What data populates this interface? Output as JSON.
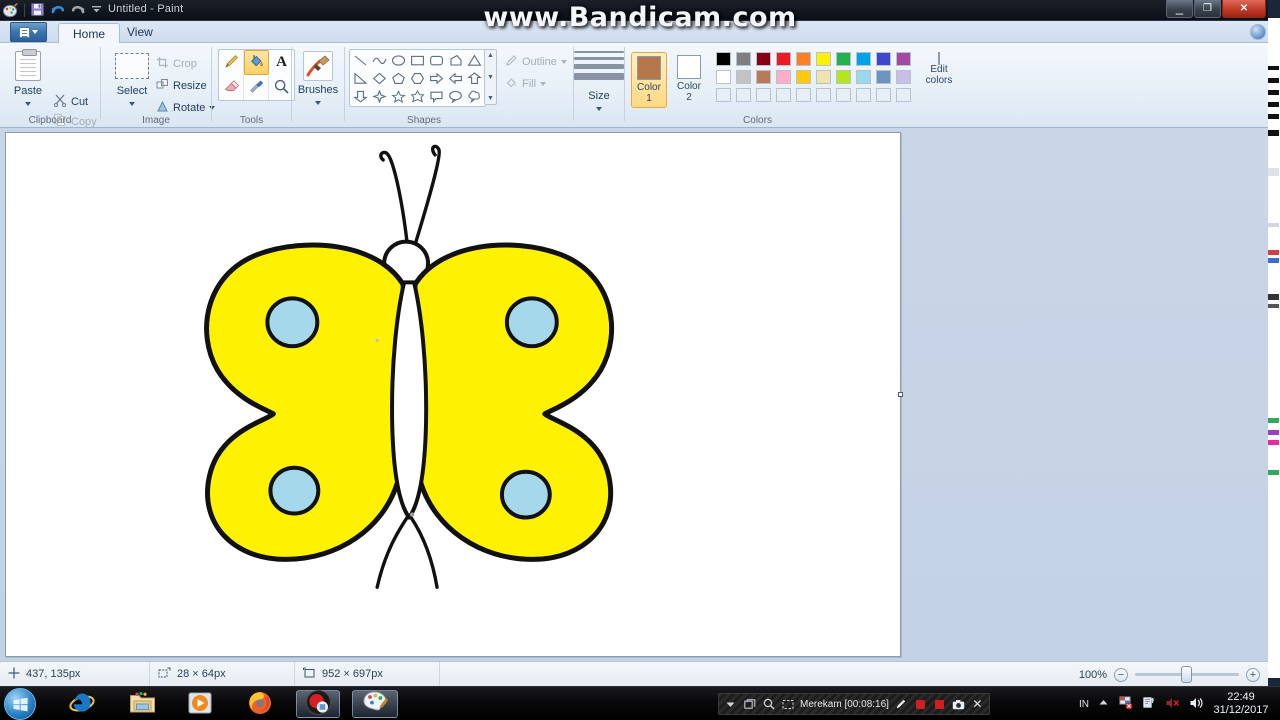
{
  "window": {
    "title": "Untitled - Paint",
    "quick_access": [
      "paint-icon",
      "save-icon",
      "undo-icon",
      "redo-icon",
      "customize-caret-icon"
    ],
    "controls": {
      "minimize": "–",
      "restore": "❐",
      "close": "✕"
    },
    "help_icon": "help-orb-icon"
  },
  "ribbon": {
    "app_menu_label": "",
    "tabs": [
      {
        "label": "Home",
        "active": true
      },
      {
        "label": "View",
        "active": false
      }
    ],
    "groups": [
      {
        "name": "Clipboard",
        "label": "Clipboard",
        "paste_label": "Paste",
        "items": [
          {
            "label": "Cut",
            "icon": "scissors-icon",
            "disabled": false
          },
          {
            "label": "Copy",
            "icon": "copy-icon",
            "disabled": true
          }
        ]
      },
      {
        "name": "Image",
        "label": "Image",
        "select_label": "Select",
        "items": [
          {
            "label": "Crop",
            "icon": "crop-icon",
            "disabled": true
          },
          {
            "label": "Resize",
            "icon": "resize-icon",
            "disabled": false
          },
          {
            "label": "Rotate",
            "icon": "rotate-icon",
            "disabled": false
          }
        ]
      },
      {
        "name": "Tools",
        "label": "Tools",
        "tools": [
          {
            "name": "pencil",
            "icon": "pencil-icon",
            "selected": false
          },
          {
            "name": "fill",
            "icon": "paint-bucket-icon",
            "selected": true
          },
          {
            "name": "text",
            "icon": "text-a-icon",
            "selected": false
          },
          {
            "name": "eraser",
            "icon": "eraser-icon",
            "selected": false
          },
          {
            "name": "color-picker",
            "icon": "eyedropper-icon",
            "selected": false
          },
          {
            "name": "magnifier",
            "icon": "magnifier-icon",
            "selected": false
          }
        ]
      },
      {
        "name": "Brushes",
        "label": "",
        "brushes_label": "Brushes"
      },
      {
        "name": "Shapes",
        "label": "Shapes",
        "outline_label": "Outline",
        "fill_label": "Fill",
        "shapes": [
          "line",
          "curve",
          "oval",
          "rectangle",
          "rounded-rectangle",
          "polygon",
          "triangle",
          "right-triangle",
          "diamond",
          "pentagon",
          "hexagon",
          "right-arrow",
          "left-arrow",
          "up-arrow",
          "down-arrow",
          "four-point-star",
          "five-point-star",
          "six-point-star",
          "rounded-callout",
          "oval-callout",
          "cloud-callout"
        ]
      },
      {
        "name": "Size",
        "label": "",
        "size_label": "Size"
      },
      {
        "name": "Colors",
        "label": "Colors",
        "color1_label": "Color\n1",
        "color1_line1": "Color",
        "color1_line2": "1",
        "color1_value": "#b5764a",
        "color2_line1": "Color",
        "color2_line2": "2",
        "color2_value": "#ffffff",
        "edit_colors_line1": "Edit",
        "edit_colors_line2": "colors",
        "palette_row1": [
          "#000000",
          "#7f7f7f",
          "#880015",
          "#ed1c24",
          "#ff7f27",
          "#fff200",
          "#22b14c",
          "#00a2e8",
          "#3f48cc",
          "#a349a4"
        ],
        "palette_row2": [
          "#ffffff",
          "#c3c3c3",
          "#b97a57",
          "#ffaec9",
          "#ffc90e",
          "#efe4b0",
          "#b5e61d",
          "#99d9ea",
          "#7092be",
          "#c8bfe7"
        ],
        "palette_row3": [
          "#e8eef6",
          "#e8eef6",
          "#e8eef6",
          "#e8eef6",
          "#e8eef6",
          "#e8eef6",
          "#e8eef6",
          "#e8eef6",
          "#e8eef6",
          "#e8eef6"
        ]
      }
    ]
  },
  "canvas": {
    "background": "#ffffff",
    "drawing_name": "butterfly-drawing",
    "wing_color": "#fff200",
    "spot_color": "#a5d8ea",
    "outline_color": "#111111"
  },
  "status": {
    "cursor_icon": "crosshair-icon",
    "cursor_position": "437, 135px",
    "selection_icon": "selection-size-icon",
    "selection_size": "28 × 64px",
    "image_icon": "image-size-icon",
    "image_size": "952 × 697px",
    "zoom_level": "100%",
    "zoom_out_icon": "minus-icon",
    "zoom_in_icon": "plus-icon"
  },
  "watermark": "www.Bandicam.com",
  "taskbar": {
    "start_icon": "windows-start-icon",
    "pinned": [
      {
        "name": "internet-explorer",
        "icon": "ie-icon",
        "active": false
      },
      {
        "name": "windows-explorer",
        "icon": "folder-icon",
        "active": false
      },
      {
        "name": "media-player",
        "icon": "media-player-icon",
        "active": false
      },
      {
        "name": "firefox",
        "icon": "firefox-icon",
        "active": false
      },
      {
        "name": "bandicam",
        "icon": "bandicam-icon",
        "active": true
      },
      {
        "name": "paint",
        "icon": "paint-palette-icon",
        "active": true
      }
    ],
    "recorder": {
      "status_text": "Merekam [00:08:16]",
      "buttons": [
        "caret-down-icon",
        "window-icon",
        "search-icon",
        "region-icon",
        "pencil-icon",
        "pause-icon",
        "record-icon",
        "camera-icon",
        "close-icon"
      ]
    },
    "tray": {
      "language": "IN",
      "show_hidden_icon": "caret-up-icon",
      "icons": [
        "flag-action-center-icon",
        "network-icon",
        "volume-muted-icon",
        "speaker-icon"
      ]
    },
    "clock_time": "22:49",
    "clock_date": "31/12/2017"
  }
}
